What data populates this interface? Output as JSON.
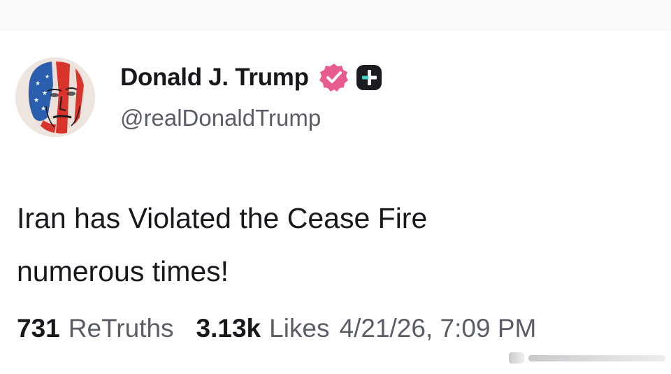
{
  "colors": {
    "text_primary": "#17181c",
    "text_secondary": "#5b5d66",
    "verified_badge": "#e85b8f",
    "plus_badge": "#1b1c22"
  },
  "author": {
    "display_name": "Donald J. Trump",
    "handle": "@realDonaldTrump",
    "avatar_icon": "portrait-flag-avatar",
    "badges": [
      "verified-icon",
      "plus-badge-icon"
    ]
  },
  "post": {
    "text_line_1": "Iran has Violated the Cease Fire",
    "text_line_2": "numerous times!"
  },
  "stats": {
    "retruths_count": "731",
    "retruths_label": "ReTruths",
    "likes_count": "3.13k",
    "likes_label": "Likes",
    "timestamp": "4/21/26, 7:09 PM"
  }
}
